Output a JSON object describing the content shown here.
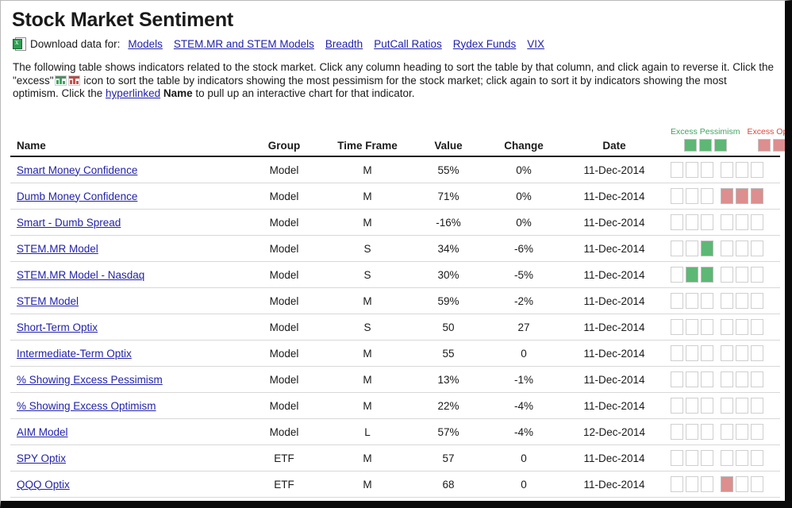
{
  "page": {
    "title": "Stock Market Sentiment"
  },
  "download": {
    "icon": "excel-spreadsheet-icon",
    "label": "Download data for:",
    "links": [
      {
        "label": "Models"
      },
      {
        "label": "STEM.MR and STEM Models"
      },
      {
        "label": "Breadth"
      },
      {
        "label": "PutCall Ratios"
      },
      {
        "label": "Rydex Funds"
      },
      {
        "label": "VIX"
      }
    ]
  },
  "intro": {
    "part1": "The following table shows indicators related to the stock market.  Click any column heading to sort the table by that column, and click again to reverse it. Click the \"excess\"",
    "part2": "icon to sort the table by indicators showing the most pessimism for the stock market; click again to sort it by indicators showing the most optimism.  Click the",
    "link": "hyperlinked",
    "bold": "Name",
    "part3": "to pull up an interactive chart for that indicator."
  },
  "table": {
    "headers": {
      "name": "Name",
      "group": "Group",
      "time_frame": "Time Frame",
      "value": "Value",
      "change": "Change",
      "date": "Date",
      "excess_pessimism": "Excess Pessimism",
      "excess_optimism": "Excess Optimism"
    },
    "colors": {
      "pessimism": "#5cb874",
      "optimism": "#dd8e8e",
      "link": "#2222aa",
      "pessimism_text": "#3fa35f",
      "optimism_text": "#e0453a"
    },
    "rows": [
      {
        "name": "Smart Money Confidence",
        "group": "Model",
        "time_frame": "M",
        "value": "55%",
        "change": "0%",
        "date": "11-Dec-2014",
        "pessimism": [
          0,
          0,
          0
        ],
        "optimism": [
          0,
          0,
          0
        ]
      },
      {
        "name": "Dumb Money Confidence",
        "group": "Model",
        "time_frame": "M",
        "value": "71%",
        "change": "0%",
        "date": "11-Dec-2014",
        "pessimism": [
          0,
          0,
          0
        ],
        "optimism": [
          1,
          1,
          1
        ]
      },
      {
        "name": "Smart - Dumb Spread",
        "group": "Model",
        "time_frame": "M",
        "value": "-16%",
        "change": "0%",
        "date": "11-Dec-2014",
        "pessimism": [
          0,
          0,
          0
        ],
        "optimism": [
          0,
          0,
          0
        ]
      },
      {
        "name": "STEM.MR Model",
        "group": "Model",
        "time_frame": "S",
        "value": "34%",
        "change": "-6%",
        "date": "11-Dec-2014",
        "pessimism": [
          0,
          0,
          1
        ],
        "optimism": [
          0,
          0,
          0
        ]
      },
      {
        "name": "STEM.MR Model - Nasdaq",
        "group": "Model",
        "time_frame": "S",
        "value": "30%",
        "change": "-5%",
        "date": "11-Dec-2014",
        "pessimism": [
          0,
          1,
          1
        ],
        "optimism": [
          0,
          0,
          0
        ]
      },
      {
        "name": "STEM Model",
        "group": "Model",
        "time_frame": "M",
        "value": "59%",
        "change": "-2%",
        "date": "11-Dec-2014",
        "pessimism": [
          0,
          0,
          0
        ],
        "optimism": [
          0,
          0,
          0
        ]
      },
      {
        "name": "Short-Term Optix",
        "group": "Model",
        "time_frame": "S",
        "value": "50",
        "change": "27",
        "date": "11-Dec-2014",
        "pessimism": [
          0,
          0,
          0
        ],
        "optimism": [
          0,
          0,
          0
        ]
      },
      {
        "name": "Intermediate-Term Optix",
        "group": "Model",
        "time_frame": "M",
        "value": "55",
        "change": "0",
        "date": "11-Dec-2014",
        "pessimism": [
          0,
          0,
          0
        ],
        "optimism": [
          0,
          0,
          0
        ]
      },
      {
        "name": "% Showing Excess Pessimism",
        "group": "Model",
        "time_frame": "M",
        "value": "13%",
        "change": "-1%",
        "date": "11-Dec-2014",
        "pessimism": [
          0,
          0,
          0
        ],
        "optimism": [
          0,
          0,
          0
        ]
      },
      {
        "name": "% Showing Excess Optimism",
        "group": "Model",
        "time_frame": "M",
        "value": "22%",
        "change": "-4%",
        "date": "11-Dec-2014",
        "pessimism": [
          0,
          0,
          0
        ],
        "optimism": [
          0,
          0,
          0
        ]
      },
      {
        "name": "AIM Model",
        "group": "Model",
        "time_frame": "L",
        "value": "57%",
        "change": "-4%",
        "date": "12-Dec-2014",
        "pessimism": [
          0,
          0,
          0
        ],
        "optimism": [
          0,
          0,
          0
        ]
      },
      {
        "name": "SPY Optix",
        "group": "ETF",
        "time_frame": "M",
        "value": "57",
        "change": "0",
        "date": "11-Dec-2014",
        "pessimism": [
          0,
          0,
          0
        ],
        "optimism": [
          0,
          0,
          0
        ]
      },
      {
        "name": "QQQ Optix",
        "group": "ETF",
        "time_frame": "M",
        "value": "68",
        "change": "0",
        "date": "11-Dec-2014",
        "pessimism": [
          0,
          0,
          0
        ],
        "optimism": [
          1,
          0,
          0
        ]
      }
    ]
  }
}
